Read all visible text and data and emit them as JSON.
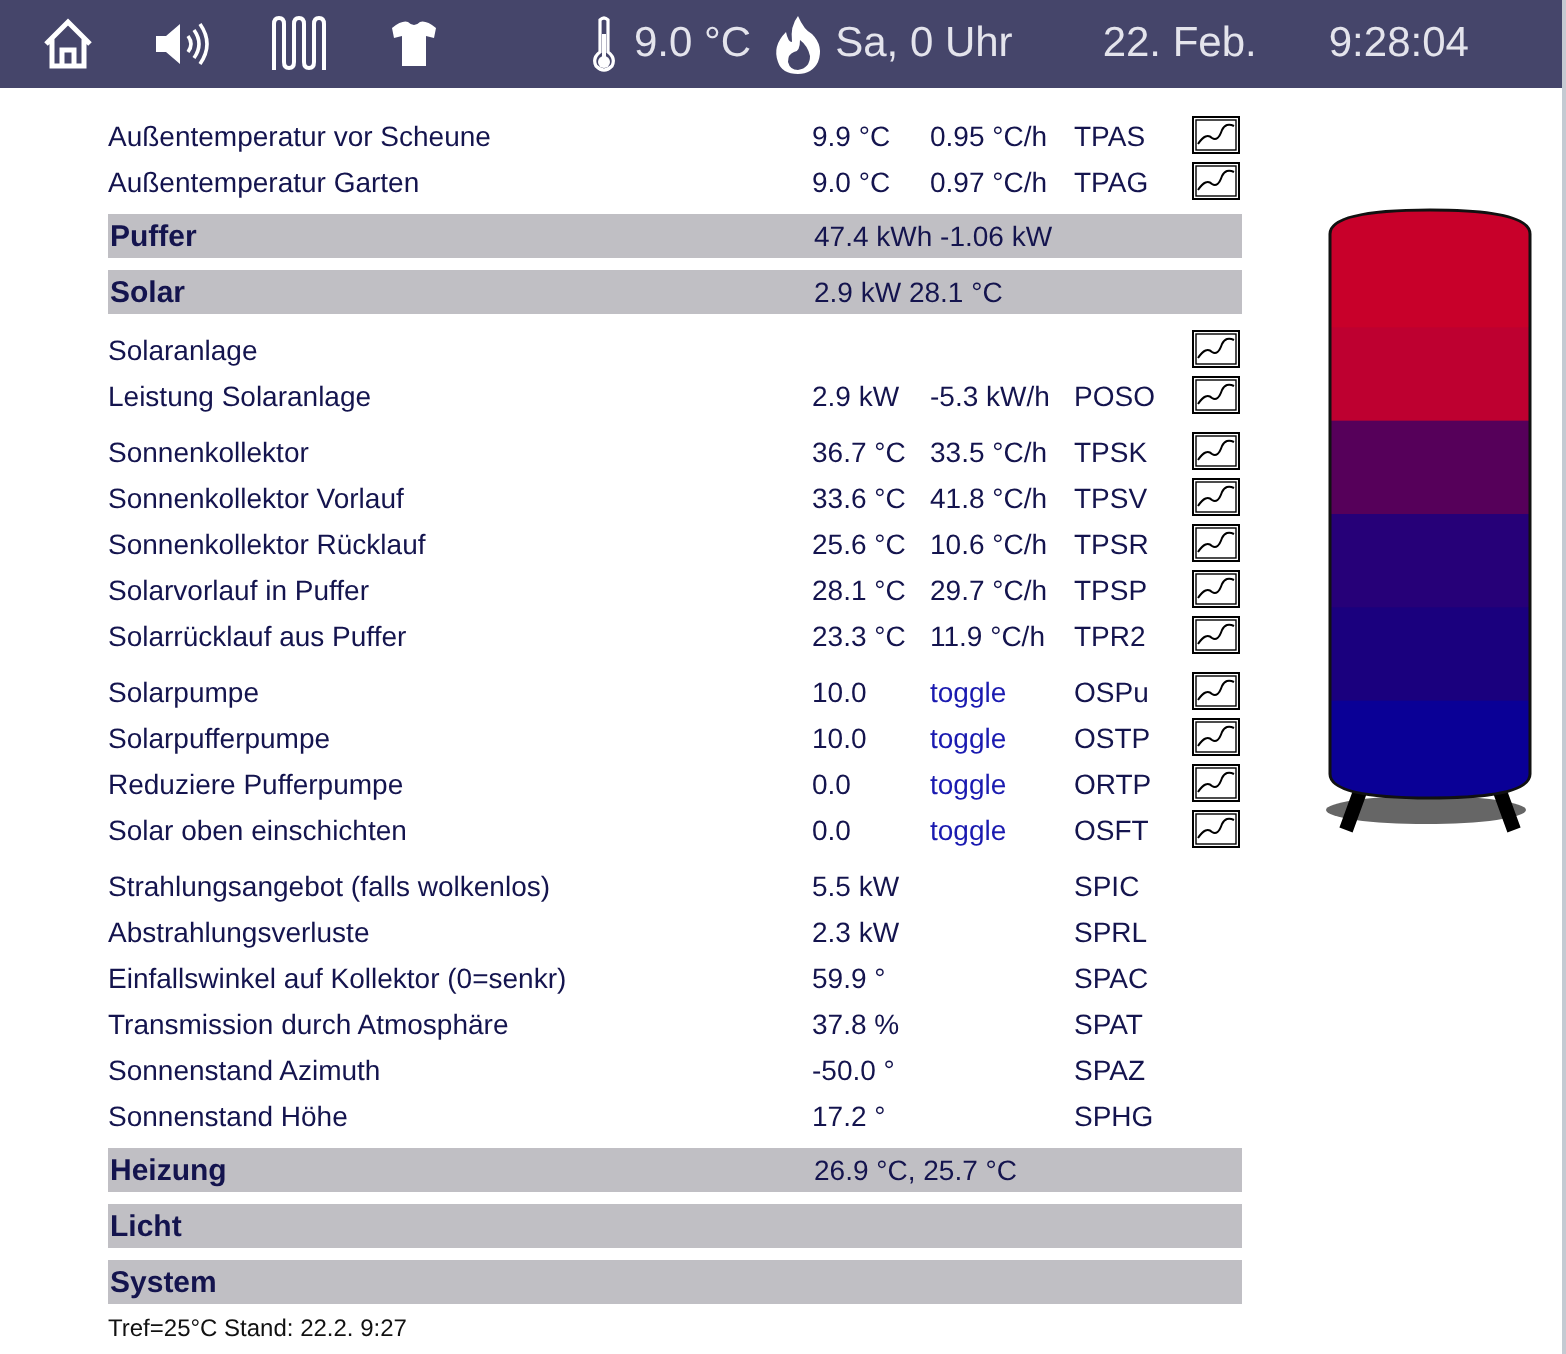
{
  "topbar": {
    "icons": [
      {
        "kind": "home"
      },
      {
        "kind": "speaker"
      },
      {
        "kind": "heater"
      },
      {
        "kind": "shirt"
      }
    ],
    "temperature": "9.0 °C",
    "schedule": "Sa, 0 Uhr",
    "date": "22. Feb.",
    "time": "9:28:04"
  },
  "sections": [
    {
      "kind": "group",
      "rows": [
        {
          "label": "Außentemperatur vor Scheune",
          "value": "9.9 °C",
          "rate": "0.95 °C/h",
          "code": "TPAS",
          "chart": true
        },
        {
          "label": "Außentemperatur Garten",
          "value": "9.0 °C",
          "rate": "0.97 °C/h",
          "code": "TPAG",
          "chart": true
        }
      ]
    },
    {
      "kind": "header",
      "title": "Puffer",
      "summary": "47.4 kWh -1.06 kW"
    },
    {
      "kind": "header",
      "title": "Solar",
      "summary": "2.9 kW 28.1 °C"
    },
    {
      "kind": "group",
      "rows": [
        {
          "label": "Solaranlage",
          "chart": true
        },
        {
          "label": "Leistung Solaranlage",
          "value": "2.9 kW",
          "rate": "-5.3 kW/h",
          "code": "POSO",
          "chart": true
        }
      ]
    },
    {
      "kind": "group",
      "rows": [
        {
          "label": "Sonnenkollektor",
          "value": "36.7 °C",
          "rate": "33.5 °C/h",
          "code": "TPSK",
          "chart": true
        },
        {
          "label": "Sonnenkollektor Vorlauf",
          "value": "33.6 °C",
          "rate": "41.8 °C/h",
          "code": "TPSV",
          "chart": true
        },
        {
          "label": "Sonnenkollektor Rücklauf",
          "value": "25.6 °C",
          "rate": "10.6 °C/h",
          "code": "TPSR",
          "chart": true
        },
        {
          "label": "Solarvorlauf in Puffer",
          "value": "28.1 °C",
          "rate": "29.7 °C/h",
          "code": "TPSP",
          "chart": true
        },
        {
          "label": "Solarrücklauf aus Puffer",
          "value": "23.3 °C",
          "rate": "11.9 °C/h",
          "code": "TPR2",
          "chart": true
        }
      ]
    },
    {
      "kind": "group",
      "rows": [
        {
          "label": "Solarpumpe",
          "value": "10.0",
          "toggle": "toggle",
          "code": "OSPu",
          "chart": true
        },
        {
          "label": "Solarpufferpumpe",
          "value": "10.0",
          "toggle": "toggle",
          "code": "OSTP",
          "chart": true
        },
        {
          "label": "Reduziere Pufferpumpe",
          "value": "0.0",
          "toggle": "toggle",
          "code": "ORTP",
          "chart": true
        },
        {
          "label": "Solar oben einschichten",
          "value": "0.0",
          "toggle": "toggle",
          "code": "OSFT",
          "chart": true
        }
      ]
    },
    {
      "kind": "group",
      "rows": [
        {
          "label": "Strahlungsangebot (falls wolkenlos)",
          "value": "5.5 kW",
          "code": "SPIC",
          "chart": false
        },
        {
          "label": "Abstrahlungsverluste",
          "value": "2.3 kW",
          "code": "SPRL",
          "chart": false
        },
        {
          "label": "Einfallswinkel auf Kollektor (0=senkr)",
          "value": "59.9 °",
          "code": "SPAC",
          "chart": false
        },
        {
          "label": "Transmission durch Atmosphäre",
          "value": "37.8 %",
          "code": "SPAT",
          "chart": false
        },
        {
          "label": "Sonnenstand Azimuth",
          "value": "-50.0 °",
          "code": "SPAZ",
          "chart": false
        },
        {
          "label": "Sonnenstand Höhe",
          "value": "17.2 °",
          "code": "SPHG",
          "chart": false
        }
      ]
    },
    {
      "kind": "header",
      "title": "Heizung",
      "summary": "26.9 °C, 25.7 °C"
    },
    {
      "kind": "header",
      "title": "Licht"
    },
    {
      "kind": "header",
      "title": "System"
    }
  ],
  "footer": "Tref=25°C Stand: 22.2. 9:27",
  "tank_layers": [
    {
      "color": "#c8002a"
    },
    {
      "color": "#be0030"
    },
    {
      "color": "#56005a"
    },
    {
      "color": "#260078"
    },
    {
      "color": "#1a007e"
    },
    {
      "color": "#0a0096"
    }
  ]
}
